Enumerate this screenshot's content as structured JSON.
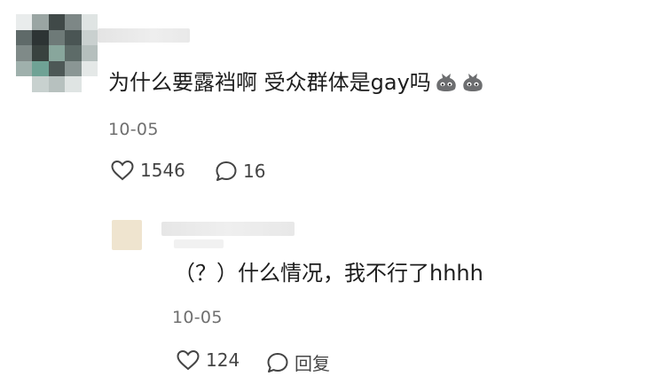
{
  "comment": {
    "text": "为什么要露裆啊 受众群体是gay吗",
    "emoji": "bag-face-emoji",
    "date": "10-05",
    "likes": "1546",
    "replies": "16"
  },
  "reply": {
    "text": "（？）什么情况，我不行了hhhh",
    "date": "10-05",
    "likes": "124",
    "reply_label": "回复"
  },
  "colors": {
    "text": "#1d1d1d",
    "meta": "#6f6f6f",
    "icon": "#444444"
  }
}
